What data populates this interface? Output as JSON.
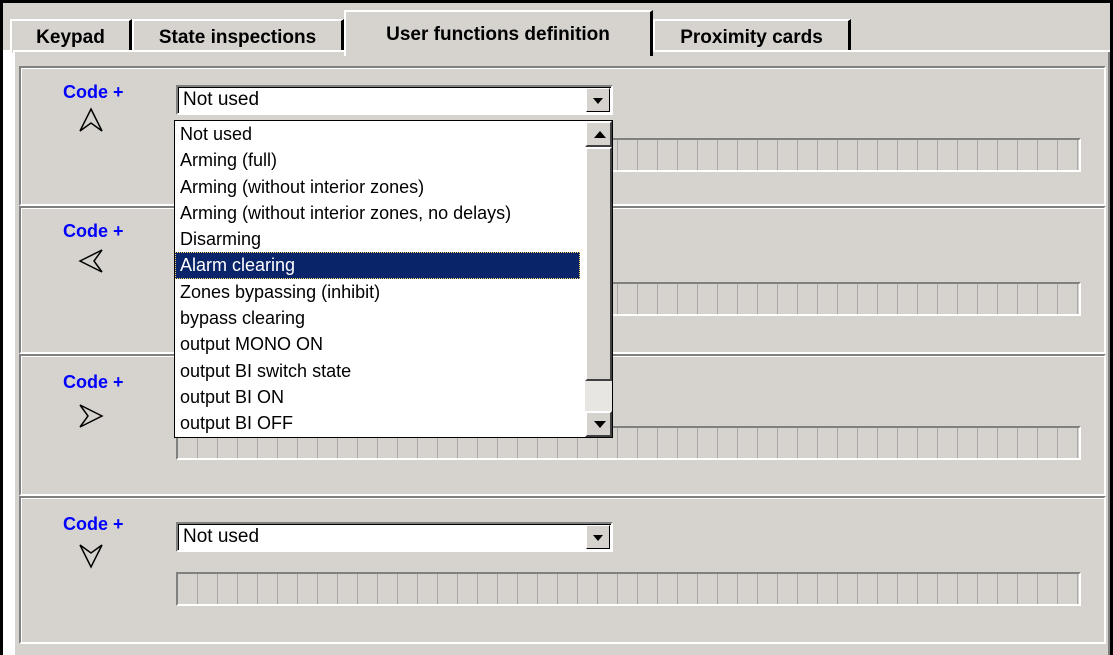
{
  "tabs": [
    {
      "label": "Keypad"
    },
    {
      "label": "State inspections"
    },
    {
      "label": "User functions definition",
      "active": true
    },
    {
      "label": "Proximity cards"
    }
  ],
  "groups": [
    {
      "label": "Code +",
      "arrow_icon": "arrow-up-icon",
      "selected": "Not used"
    },
    {
      "label": "Code +",
      "arrow_icon": "arrow-left-icon",
      "selected": ""
    },
    {
      "label": "Code +",
      "arrow_icon": "arrow-right-icon",
      "selected": ""
    },
    {
      "label": "Code +",
      "arrow_icon": "arrow-down-icon",
      "selected": "Not used"
    }
  ],
  "dropdown": {
    "options": [
      "Not used",
      "Arming (full)",
      "Arming (without interior zones)",
      "Arming (without interior zones, no delays)",
      "Disarming",
      "Alarm clearing",
      "Zones bypassing (inhibit)",
      "bypass clearing",
      "output MONO ON",
      "output BI switch state",
      "output BI ON",
      "output BI OFF"
    ],
    "highlighted": "Alarm clearing"
  },
  "colors": {
    "window_bg": "#d6d3ce",
    "code_label": "#0000ff",
    "selection_bg": "#0a246a"
  }
}
